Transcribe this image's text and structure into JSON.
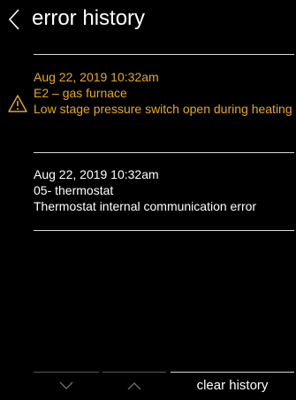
{
  "header": {
    "title": "error history",
    "back_icon": "chevron-left-icon"
  },
  "colors": {
    "background": "#000000",
    "active_error": "#e6a91c",
    "text": "#ffffff",
    "divider": "#d8d8d8"
  },
  "errors": [
    {
      "timestamp": "Aug 22, 2019 10:32am",
      "source": "E2 – gas furnace",
      "message": "Low stage pressure switch open during heating",
      "icon": "warning-icon",
      "status": "active"
    },
    {
      "timestamp": "Aug 22, 2019 10:32am",
      "source": "05- thermostat",
      "message": "Thermostat internal communication error",
      "icon": "",
      "status": "cleared"
    }
  ],
  "footer": {
    "scroll_down_icon": "chevron-down-icon",
    "scroll_up_icon": "chevron-up-icon",
    "clear_label": "clear history"
  }
}
